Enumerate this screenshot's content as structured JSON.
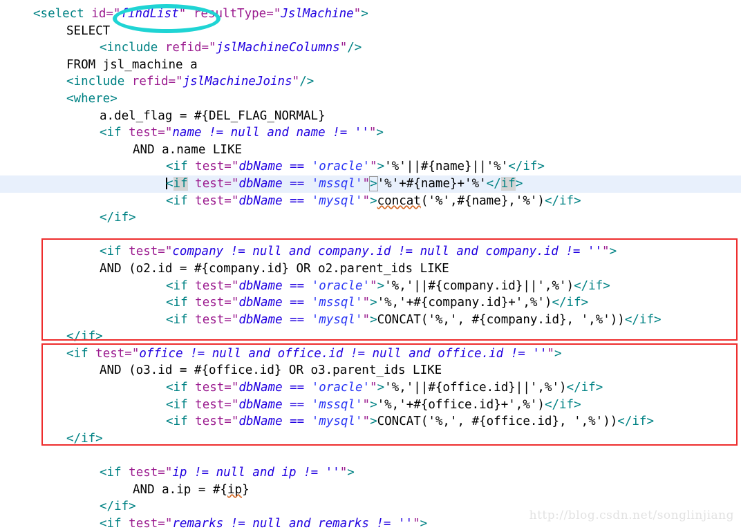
{
  "editor": {
    "language": "xml-mybatis-mapper",
    "theme_background": "#ffffff",
    "current_line_background": "#e8f0fc",
    "colors": {
      "tag": "#008284",
      "attribute_name": "#9b1b8f",
      "attribute_value": "#2000e0",
      "nested_string": "#2a36f5",
      "plain_text": "#000000",
      "bracket_match_highlight": "#d4d4d4",
      "annotation_box": "#ee2d2d",
      "annotation_ellipse": "#1fd4d4",
      "watermark": "#e2e2e2"
    }
  },
  "code": {
    "lines": [
      {
        "n": 1,
        "indent": 0,
        "text": "<select id=\"findList\" resultType=\"JslMachine\">"
      },
      {
        "n": 2,
        "indent": 1,
        "text": "SELECT"
      },
      {
        "n": 3,
        "indent": 2,
        "text": "<include refid=\"jslMachineColumns\"/>"
      },
      {
        "n": 4,
        "indent": 1,
        "text": "FROM jsl_machine a"
      },
      {
        "n": 5,
        "indent": 1,
        "text": "<include refid=\"jslMachineJoins\"/>"
      },
      {
        "n": 6,
        "indent": 1,
        "text": "<where>"
      },
      {
        "n": 7,
        "indent": 2,
        "text": "a.del_flag = #{DEL_FLAG_NORMAL}"
      },
      {
        "n": 8,
        "indent": 2,
        "text": "<if test=\"name != null and name != ''\">"
      },
      {
        "n": 9,
        "indent": 3,
        "text": "AND a.name LIKE"
      },
      {
        "n": 10,
        "indent": 4,
        "text": "<if test=\"dbName == 'oracle'\">'%'||#{name}||'%'</if>"
      },
      {
        "n": 11,
        "indent": 4,
        "text": "<if test=\"dbName == 'mssql'\">'%'+#{name}+'%'</if>",
        "current": true
      },
      {
        "n": 12,
        "indent": 4,
        "text": "<if test=\"dbName == 'mysql'\">concat('%',#{name},'%')</if>"
      },
      {
        "n": 13,
        "indent": 2,
        "text": "</if>"
      },
      {
        "n": 14,
        "indent": 0,
        "text": ""
      },
      {
        "n": 15,
        "indent": 3,
        "text": "<if test=\"company != null and company.id != null and company.id != ''\">"
      },
      {
        "n": 16,
        "indent": 2,
        "text": "AND (o2.id = #{company.id} OR o2.parent_ids LIKE"
      },
      {
        "n": 17,
        "indent": 4,
        "text": "<if test=\"dbName == 'oracle'\">'%,'||#{company.id}||',%')</if>"
      },
      {
        "n": 18,
        "indent": 4,
        "text": "<if test=\"dbName == 'mssql'\">'%,'+#{company.id}+',%')</if>"
      },
      {
        "n": 19,
        "indent": 4,
        "text": "<if test=\"dbName == 'mysql'\">CONCAT('%,', #{company.id}, ',%'))</if>"
      },
      {
        "n": 20,
        "indent": 1,
        "text": "</if>"
      },
      {
        "n": 21,
        "indent": 1,
        "text": "<if test=\"office != null and office.id != null and office.id != ''\">"
      },
      {
        "n": 22,
        "indent": 2,
        "text": "AND (o3.id = #{office.id} OR o3.parent_ids LIKE"
      },
      {
        "n": 23,
        "indent": 4,
        "text": "<if test=\"dbName == 'oracle'\">'%,'||#{office.id}||',%')</if>"
      },
      {
        "n": 24,
        "indent": 4,
        "text": "<if test=\"dbName == 'mssql'\">'%,'+#{office.id}+',%')</if>"
      },
      {
        "n": 25,
        "indent": 4,
        "text": "<if test=\"dbName == 'mysql'\">CONCAT('%,', #{office.id}, ',%'))</if>"
      },
      {
        "n": 26,
        "indent": 1,
        "text": "</if>"
      },
      {
        "n": 27,
        "indent": 0,
        "text": ""
      },
      {
        "n": 28,
        "indent": 3,
        "text": "<if test=\"ip != null and ip != ''\">"
      },
      {
        "n": 29,
        "indent": 3,
        "text": "AND a.ip = #{ip}"
      },
      {
        "n": 30,
        "indent": 3,
        "text": "</if>"
      },
      {
        "n": 31,
        "indent": 3,
        "text": "<if test=\"remarks != null and remarks != ''\">"
      }
    ]
  },
  "tokens": {
    "l1": {
      "open": "<select ",
      "attr_id": "id=",
      "q1": "\"",
      "val_findlist": "findList",
      "q2": "\"",
      "space": " ",
      "attr_resulttype": "resultType=",
      "q3": "\"",
      "val_jslmachine": "JslMachine",
      "q4": "\"",
      "close": ">"
    },
    "l2_select": "SELECT",
    "l3": {
      "open": "<include ",
      "attr": "refid=",
      "q1": "\"",
      "val": "jslMachineColumns",
      "q2": "\"",
      "close": "/>"
    },
    "l4_from": "FROM jsl_machine a",
    "l5": {
      "open": "<include ",
      "attr": "refid=",
      "q1": "\"",
      "val": "jslMachineJoins",
      "q2": "\"",
      "close": "/>"
    },
    "l6_where": "<where>",
    "l7_delflag": "a.del_flag = #{DEL_FLAG_NORMAL}",
    "l8": {
      "open": "<if ",
      "attr": "test=",
      "q1": "\"",
      "val": "name != null and name != ''",
      "q2": "\"",
      "close": ">"
    },
    "l9_and": "AND a.name LIKE",
    "l10": {
      "open": "<if ",
      "attr": "test=",
      "q1": "\"",
      "val_a": "dbName == ",
      "val_b": "'oracle'",
      "q2": "\"",
      "gt": ">",
      "body": "'%'||#{name}||'%'",
      "end": "</if>"
    },
    "l11": {
      "open_lt": "<",
      "open_if": "if",
      "sp": " ",
      "attr": "test=",
      "q1": "\"",
      "val_a": "dbName == ",
      "val_b": "'mssql'",
      "q2": "\"",
      "gt": ">",
      "body": "'%'+#{name}+'%'",
      "end_lt": "</",
      "end_if": "if",
      "end_gt": ">"
    },
    "l12": {
      "open": "<if ",
      "attr": "test=",
      "q1": "\"",
      "val_a": "dbName == ",
      "val_b": "'mysql'",
      "q2": "\"",
      "gt": ">",
      "body_fn": "concat",
      "body_rest": "('%',#{name},'%')",
      "end": "</if>"
    },
    "l13_endif": "</if>",
    "l15": {
      "open": "<if ",
      "attr": "test=",
      "q1": "\"",
      "val": "company != null and company.id != null and company.id != ''",
      "q2": "\"",
      "close": ">"
    },
    "l16_and": "AND (o2.id = #{company.id} OR o2.parent_ids LIKE",
    "l17": {
      "open": "<if ",
      "attr": "test=",
      "q1": "\"",
      "val_a": "dbName == ",
      "val_b": "'oracle'",
      "q2": "\"",
      "gt": ">",
      "body": "'%,'||#{company.id}||',%')",
      "end": "</if>"
    },
    "l18": {
      "open": "<if ",
      "attr": "test=",
      "q1": "\"",
      "val_a": "dbName == ",
      "val_b": "'mssql'",
      "q2": "\"",
      "gt": ">",
      "body": "'%,'+#{company.id}+',%')",
      "end": "</if>"
    },
    "l19": {
      "open": "<if ",
      "attr": "test=",
      "q1": "\"",
      "val_a": "dbName == ",
      "val_b": "'mysql'",
      "q2": "\"",
      "gt": ">",
      "body": "CONCAT('%,', #{company.id}, ',%'))",
      "end": "</if>"
    },
    "l20_endif": "</if>",
    "l21": {
      "open": "<if ",
      "attr": "test=",
      "q1": "\"",
      "val": "office != null and office.id != null and office.id != ''",
      "q2": "\"",
      "close": ">"
    },
    "l22_and": "AND (o3.id = #{office.id} OR o3.parent_ids LIKE",
    "l23": {
      "open": "<if ",
      "attr": "test=",
      "q1": "\"",
      "val_a": "dbName == ",
      "val_b": "'oracle'",
      "q2": "\"",
      "gt": ">",
      "body": "'%,'||#{office.id}||',%')",
      "end": "</if>"
    },
    "l24": {
      "open": "<if ",
      "attr": "test=",
      "q1": "\"",
      "val_a": "dbName == ",
      "val_b": "'mssql'",
      "q2": "\"",
      "gt": ">",
      "body": "'%,'+#{office.id}+',%')",
      "end": "</if>"
    },
    "l25": {
      "open": "<if ",
      "attr": "test=",
      "q1": "\"",
      "val_a": "dbName == ",
      "val_b": "'mysql'",
      "q2": "\"",
      "gt": ">",
      "body": "CONCAT('%,', #{office.id}, ',%'))",
      "end": "</if>"
    },
    "l26_endif": "</if>",
    "l28": {
      "open": "<if ",
      "attr": "test=",
      "q1": "\"",
      "val": "ip != null and ip != ''",
      "q2": "\"",
      "close": ">"
    },
    "l29_and_a": "AND a.",
    "l29_ip": "ip",
    "l29_and_b": " = #{",
    "l29_ip2": "ip",
    "l29_and_c": "}",
    "l30_endif": "</if>",
    "l31": {
      "open": "<if ",
      "attr": "test=",
      "q1": "\"",
      "val": "remarks != null and remarks != ''",
      "q2": "\"",
      "close": ">"
    }
  },
  "annotations": {
    "ellipse_target": "findList",
    "box_company_label": "company-condition-block",
    "box_office_label": "office-condition-block"
  },
  "watermark": {
    "text": "http://blog.csdn.net/songlinjiang"
  }
}
